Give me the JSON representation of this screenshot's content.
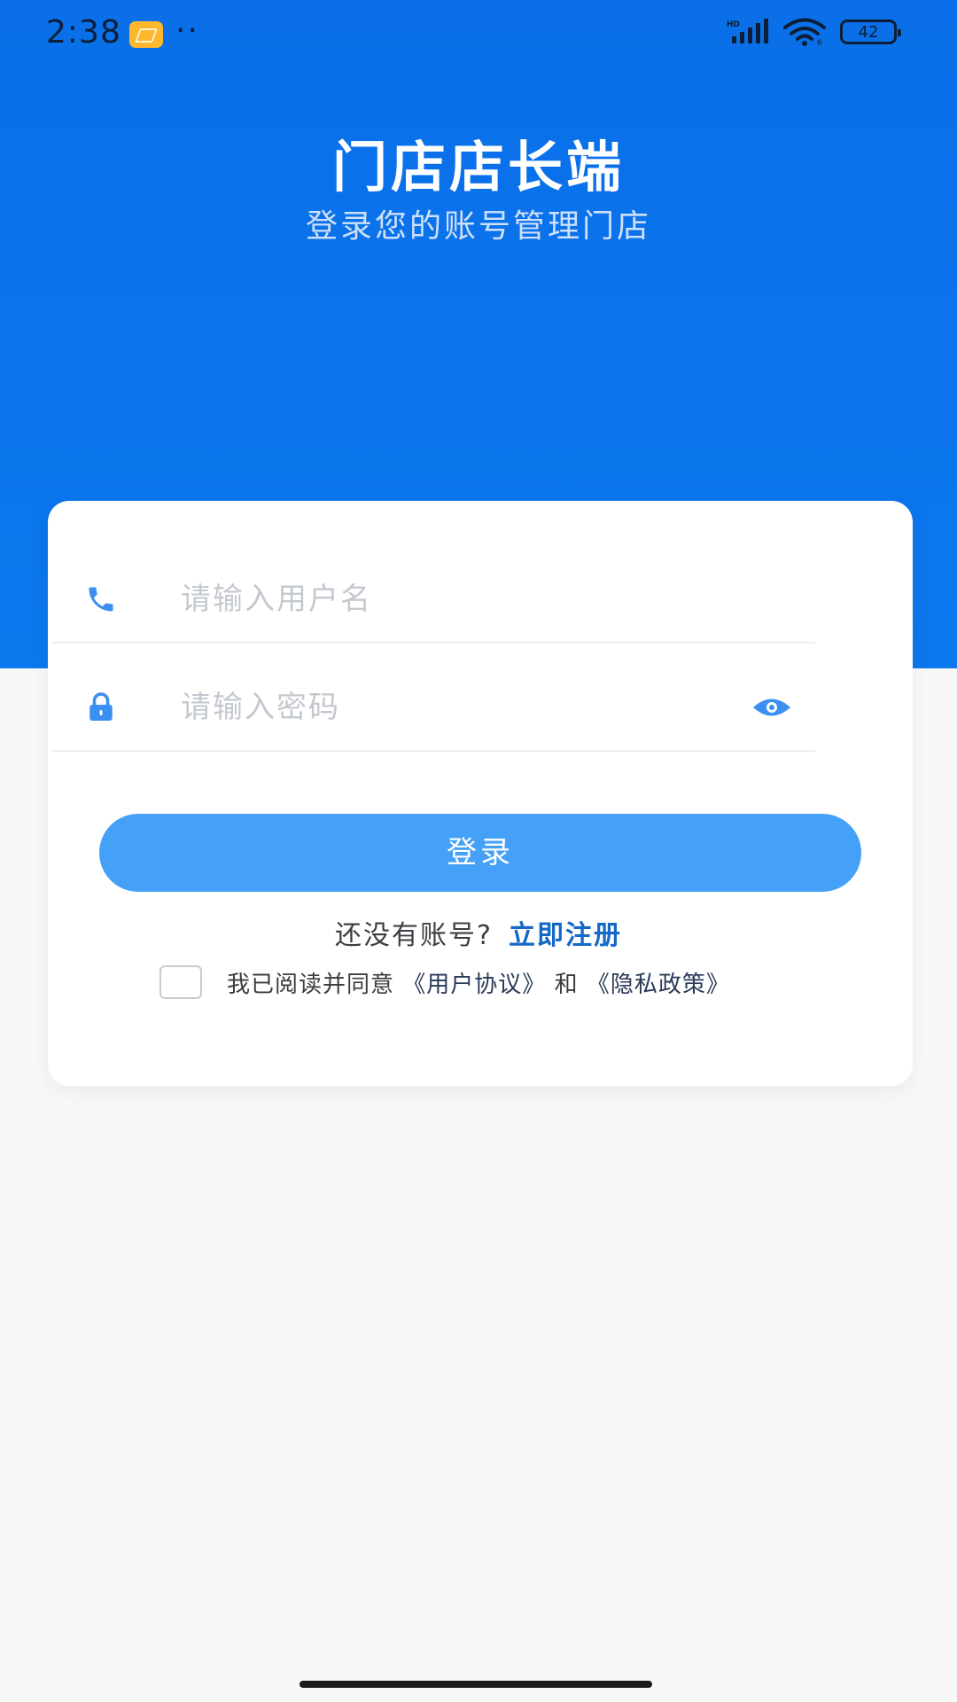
{
  "status_bar": {
    "time": "2:38",
    "dots": "··",
    "battery": "42"
  },
  "header": {
    "title": "门店店长端",
    "subtitle": "登录您的账号管理门店"
  },
  "form": {
    "username_placeholder": "请输入用户名",
    "password_placeholder": "请输入密码",
    "login_label": "登录",
    "no_account_text": "还没有账号?",
    "register_label": "立即注册",
    "agree_prefix": "我已阅读并同意",
    "user_agreement": "《用户协议》",
    "and_text": "和",
    "privacy_policy": "《隐私政策》"
  },
  "icons": {
    "phone": "phone-icon",
    "lock": "lock-icon",
    "eye": "eye-icon",
    "notification": "gallery-notification-icon",
    "signal": "signal-icon",
    "wifi": "wifi-icon",
    "battery": "battery-icon"
  },
  "colors": {
    "primary": "#0b74ec",
    "button": "#45a1f7",
    "link": "#1468c6",
    "icon_blue": "#3a8ff0"
  }
}
